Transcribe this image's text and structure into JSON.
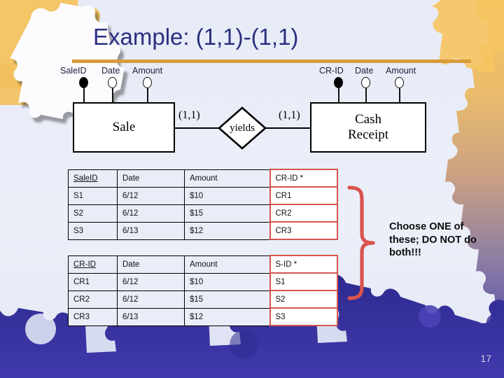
{
  "slide": {
    "title": "Example: (1,1)-(1,1)",
    "page_number": "17",
    "accent_rule_color": "#d79c3c",
    "title_color": "#2b2f7f",
    "background_color": "#eaeef8",
    "bottom_band_color": "#3b35a6",
    "highlight_color": "#d4554c"
  },
  "er_diagram": {
    "left_entity": {
      "name": "Sale",
      "attributes": [
        {
          "label": "SaleID",
          "key": true
        },
        {
          "label": "Date",
          "key": false
        },
        {
          "label": "Amount",
          "key": false
        }
      ]
    },
    "right_entity": {
      "name_line1": "Cash",
      "name_line2": "Receipt",
      "attributes": [
        {
          "label": "CR-ID",
          "key": true
        },
        {
          "label": "Date",
          "key": false
        },
        {
          "label": "Amount",
          "key": false
        }
      ]
    },
    "relationship": {
      "label": "yields",
      "left_cardinality": "(1,1)",
      "right_cardinality": "(1,1)"
    }
  },
  "tables": [
    {
      "name": "sale-table",
      "headers": [
        "SaleID",
        "Date",
        "Amount",
        "CR-ID *"
      ],
      "rows": [
        [
          "S1",
          "6/12",
          "$10",
          "CR1"
        ],
        [
          "S2",
          "6/12",
          "$15",
          "CR2"
        ],
        [
          "S3",
          "6/13",
          "$12",
          "CR3"
        ]
      ]
    },
    {
      "name": "cash-receipt-table",
      "headers": [
        "CR-ID",
        "Date",
        "Amount",
        "S-ID *"
      ],
      "rows": [
        [
          "CR1",
          "6/12",
          "$10",
          "S1"
        ],
        [
          "CR2",
          "6/12",
          "$15",
          "S2"
        ],
        [
          "CR3",
          "6/13",
          "$12",
          "S3"
        ]
      ]
    }
  ],
  "annotation": {
    "text": "Choose ONE of these; DO NOT do both!!!"
  }
}
